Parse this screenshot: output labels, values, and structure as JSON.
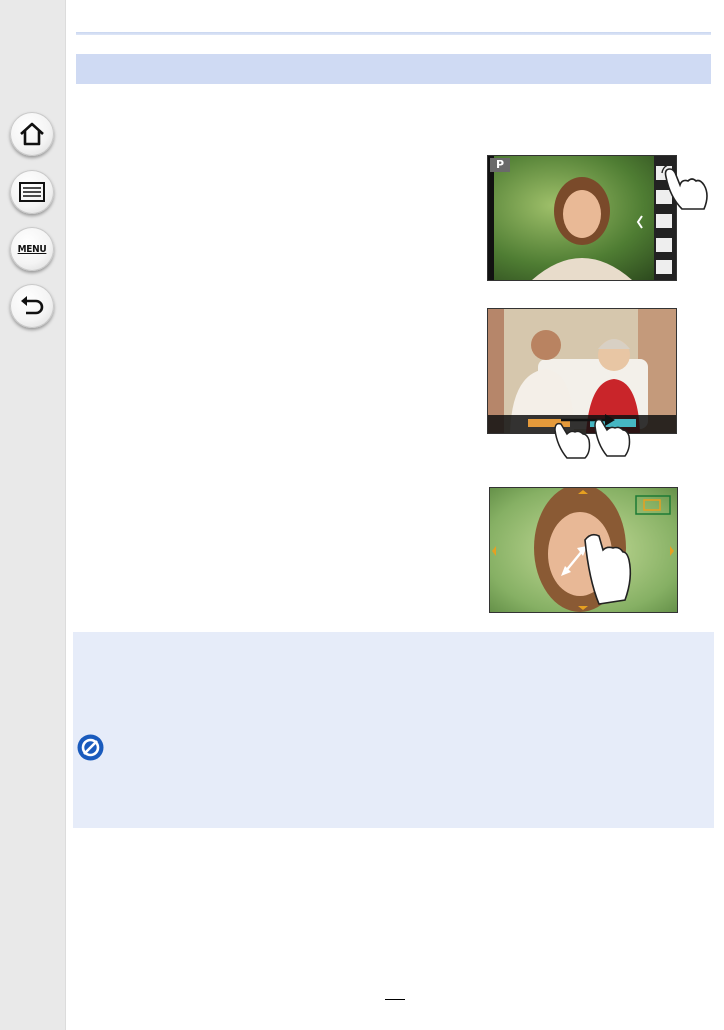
{
  "sidebar": {
    "buttons": [
      {
        "id": "home",
        "icon": "home-icon"
      },
      {
        "id": "contents",
        "icon": "list-icon"
      },
      {
        "id": "menu",
        "icon": "menu-text-icon",
        "label": "MENU"
      },
      {
        "id": "back",
        "icon": "back-arrow-icon"
      }
    ]
  },
  "illustrations": {
    "touch_tab": {
      "mode_label": "P"
    },
    "slide_bar": {},
    "pinch": {}
  },
  "colors": {
    "sidebar_bg": "#e9e9e9",
    "header_band": "#cfdaf3",
    "note_box": "#e6ecf9",
    "accent_blue": "#1a5bbd"
  }
}
